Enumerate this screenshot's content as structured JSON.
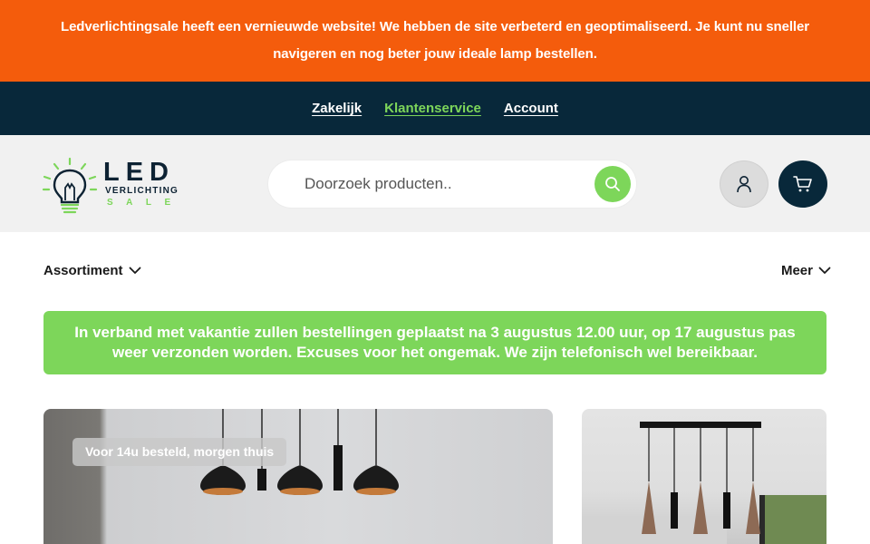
{
  "announcement": {
    "text": "Ledverlichtingsale heeft een vernieuwde website! We hebben de site verbeterd en geoptimaliseerd. Je kunt nu sneller navigeren en nog beter jouw ideale lamp bestellen."
  },
  "top_nav": {
    "items": [
      {
        "label": "Zakelijk"
      },
      {
        "label": "Klantenservice"
      },
      {
        "label": "Account"
      }
    ]
  },
  "logo": {
    "letters": "LED",
    "sub": "VERLICHTING",
    "sale": "SALE"
  },
  "search": {
    "placeholder": "Doorzoek producten.."
  },
  "menu": {
    "left_label": "Assortiment",
    "right_label": "Meer"
  },
  "notice": {
    "text": "In verband met vakantie zullen bestellingen geplaatst na 3 augustus 12.00 uur, op 17 augustus pas weer verzonden worden. Excuses voor het ongemak. We zijn telefonisch wel bereikbaar."
  },
  "banner": {
    "badge": "Voor 14u besteld, morgen thuis"
  },
  "colors": {
    "accent_orange": "#f45c0c",
    "navy": "#08283a",
    "green": "#7dd65a"
  },
  "icons": {
    "search": "magnifier-icon",
    "account": "user-icon",
    "cart": "cart-icon",
    "chevron": "chevron-down-icon",
    "logo": "lightbulb-icon"
  }
}
